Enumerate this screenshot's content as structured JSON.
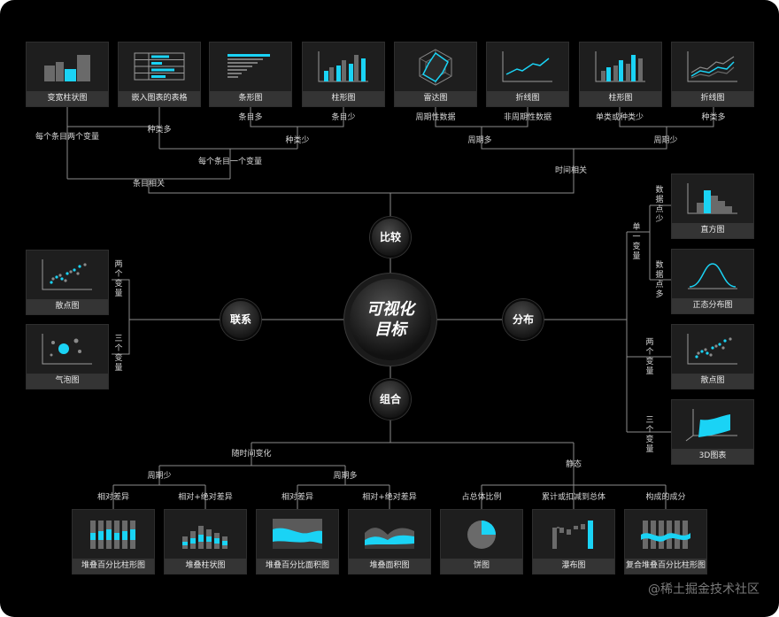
{
  "center": {
    "line1": "可视化",
    "line2": "目标"
  },
  "nodes": {
    "compare": "比较",
    "relation": "联系",
    "distribution": "分布",
    "composition": "组合"
  },
  "top_cards": [
    {
      "caption": "变宽柱状图",
      "icon": "variable-width-bar-chart-icon"
    },
    {
      "caption": "嵌入图表的表格",
      "icon": "table-with-charts-icon"
    },
    {
      "caption": "条形图",
      "icon": "horizontal-bar-chart-icon"
    },
    {
      "caption": "柱形图",
      "icon": "column-chart-icon"
    },
    {
      "caption": "雷达图",
      "icon": "radar-chart-icon"
    },
    {
      "caption": "折线图",
      "icon": "line-chart-icon"
    },
    {
      "caption": "柱形图",
      "icon": "column-chart-icon"
    },
    {
      "caption": "折线图",
      "icon": "multi-line-chart-icon"
    }
  ],
  "left_cards": [
    {
      "caption": "散点图",
      "icon": "scatter-plot-icon"
    },
    {
      "caption": "气泡图",
      "icon": "bubble-chart-icon"
    }
  ],
  "right_cards": [
    {
      "caption": "直方图",
      "icon": "histogram-icon"
    },
    {
      "caption": "正态分布图",
      "icon": "normal-distribution-icon"
    },
    {
      "caption": "散点图",
      "icon": "scatter-plot-icon"
    },
    {
      "caption": "3D图表",
      "icon": "3d-surface-chart-icon"
    }
  ],
  "bottom_cards": [
    {
      "caption": "堆叠百分比柱形图",
      "icon": "stacked-percent-column-icon"
    },
    {
      "caption": "堆叠柱状图",
      "icon": "stacked-column-icon"
    },
    {
      "caption": "堆叠百分比面积图",
      "icon": "stacked-percent-area-icon"
    },
    {
      "caption": "堆叠面积图",
      "icon": "stacked-area-icon"
    },
    {
      "caption": "饼图",
      "icon": "pie-chart-icon"
    },
    {
      "caption": "瀑布图",
      "icon": "waterfall-chart-icon"
    },
    {
      "caption": "复合堆叠百分比柱形图",
      "icon": "combo-stacked-percent-column-icon"
    }
  ],
  "labels": {
    "two_vars_per_item": "每个条目两个变量",
    "many_categories": "种类多",
    "many_items": "条目多",
    "few_items": "条目少",
    "few_categories": "种类少",
    "one_var_per_item": "每个条目一个变量",
    "item_related": "条目相关",
    "periodic": "周期性数据",
    "non_periodic": "非周期性数据",
    "single_or_few": "单类或种类少",
    "many_categories_2": "种类多",
    "many_periods": "周期多",
    "few_periods": "周期少",
    "time_related": "时间相关",
    "two_vars_left": "两个变量",
    "three_vars_left": "三个变量",
    "single_var": "单一变量",
    "few_points": "数据点少",
    "many_points": "数据点多",
    "two_vars_right": "两个变量",
    "three_vars_right": "三个变量",
    "over_time": "随时间变化",
    "static": "静态",
    "few_periods_2": "周期少",
    "many_periods_2": "周期多",
    "relative_diff": "相对差异",
    "rel_abs_diff": "相对+绝对差异",
    "relative_diff_2": "相对差异",
    "rel_abs_diff_2": "相对+绝对差异",
    "share_of_total": "占总体比例",
    "cumulative": "累计或扣减到总体",
    "components": "构成的成分"
  },
  "watermark": "@稀土掘金技术社区",
  "colors": {
    "accent": "#1ad3f5",
    "line": "#8a8a8a",
    "bar_gray": "#6a6a6a"
  }
}
